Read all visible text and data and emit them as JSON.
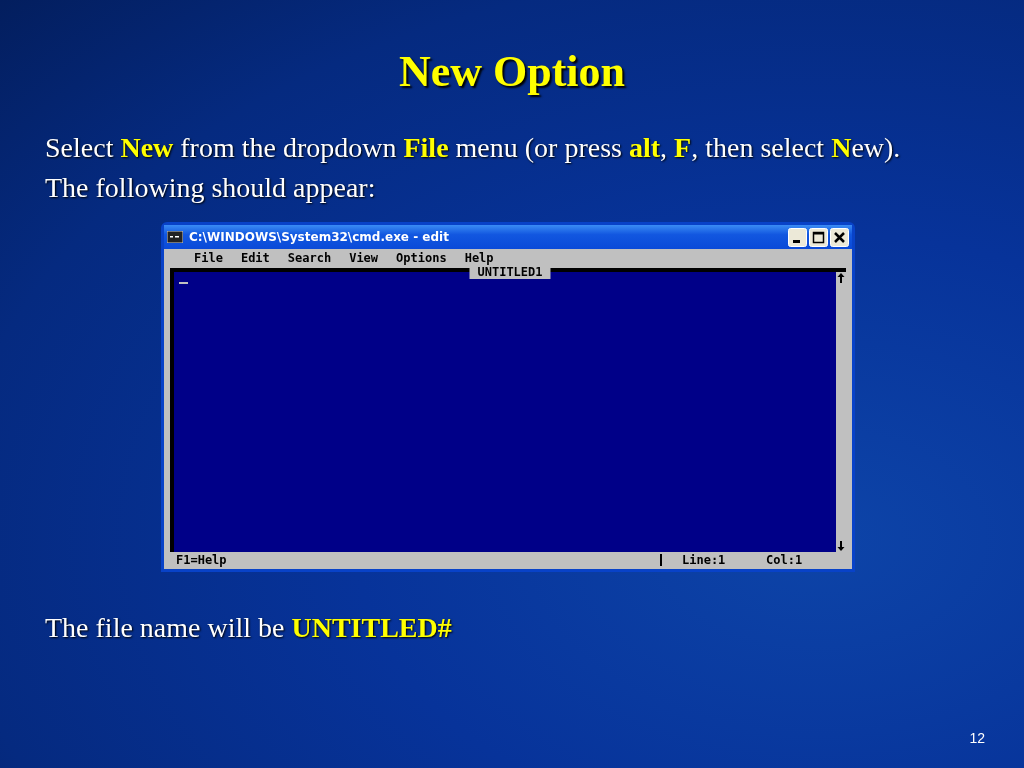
{
  "slide": {
    "title": "New Option",
    "intro": "Select **New** from the dropdown **File** menu (or press **alt**, **F**, then select **N**ew). The following should appear:",
    "note": "The file name will be **UNTITLED#**",
    "page_number": "12"
  },
  "window": {
    "title": "C:\\WINDOWS\\System32\\cmd.exe - edit",
    "menu": [
      "File",
      "Edit",
      "Search",
      "View",
      "Options",
      "Help"
    ],
    "document_title": "UNTITLED1",
    "status_bar": {
      "hint": "F1=Help",
      "line": "Line:1",
      "column": "Col:1"
    }
  }
}
